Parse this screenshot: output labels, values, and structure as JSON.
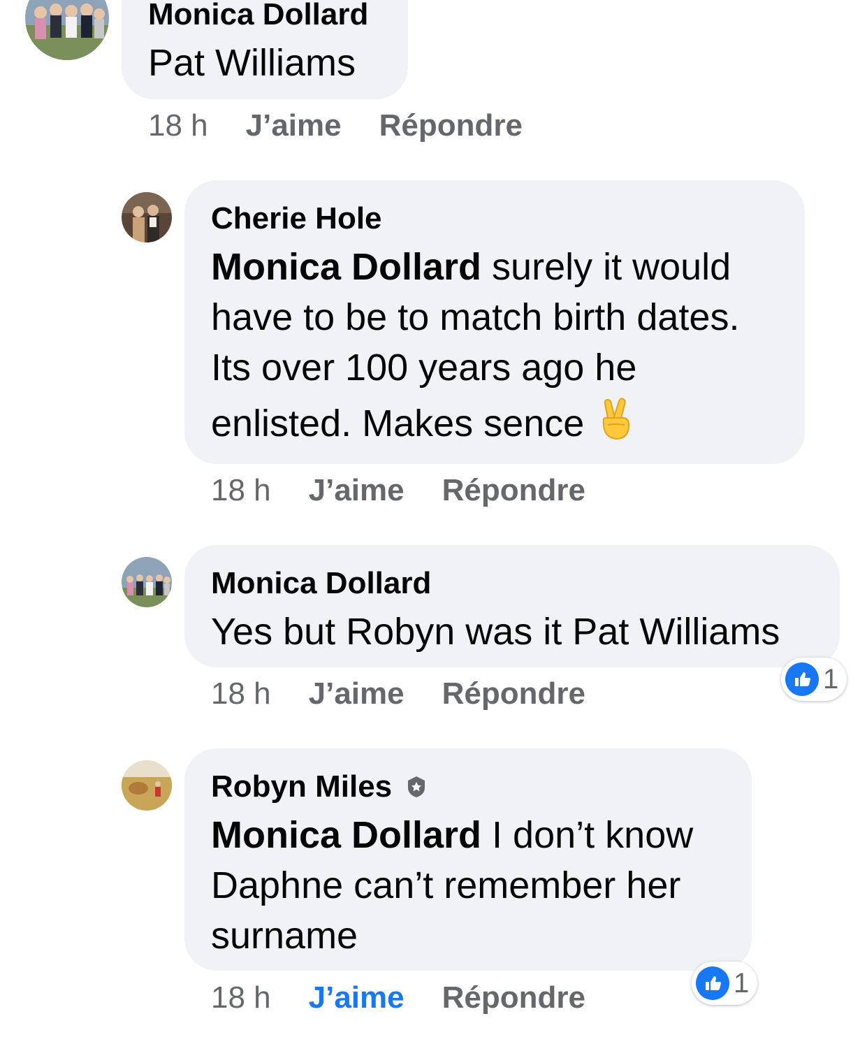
{
  "colors": {
    "bubble": "#f0f2f5",
    "meta_text": "#65676b",
    "like_active": "#1877f2",
    "reaction_badge": "#1877f2"
  },
  "comments": [
    {
      "author": "Monica Dollard",
      "avatar": "group-photo-avatar",
      "lines": [
        [
          {
            "text": "Pat Williams",
            "bold": false
          }
        ]
      ],
      "time": "18 h",
      "like_label": "J’aime",
      "reply_label": "Répondre"
    },
    {
      "author": "Cherie Hole",
      "avatar": "couple-photo-avatar",
      "lines": [
        [
          {
            "text": "Monica Dollard",
            "bold": true
          },
          {
            "text": " surely it would",
            "bold": false
          }
        ],
        [
          {
            "text": "have to be to match birth dates.",
            "bold": false
          }
        ],
        [
          {
            "text": "Its over 100 years ago he",
            "bold": false
          }
        ],
        [
          {
            "text": "enlisted. Makes sence",
            "bold": false
          }
        ]
      ],
      "trailing_emoji": "crossed-fingers-emoji",
      "time": "18 h",
      "like_label": "J’aime",
      "reply_label": "Répondre"
    },
    {
      "author": "Monica Dollard",
      "avatar": "group-photo-avatar",
      "lines": [
        [
          {
            "text": "Yes but Robyn was it Pat Williams",
            "bold": false
          }
        ]
      ],
      "time": "18 h",
      "like_label": "J’aime",
      "reply_label": "Répondre",
      "reaction_icon": "thumbs-up-icon",
      "reaction_count": "1"
    },
    {
      "author": "Robyn Miles",
      "avatar": "field-photo-avatar",
      "author_badge": "top-fan-badge-icon",
      "lines": [
        [
          {
            "text": "Monica Dollard",
            "bold": true
          },
          {
            "text": " I don’t know",
            "bold": false
          }
        ],
        [
          {
            "text": "Daphne can’t remember her",
            "bold": false
          }
        ],
        [
          {
            "text": "surname",
            "bold": false
          }
        ]
      ],
      "time": "18 h",
      "like_label": "J’aime",
      "like_active": true,
      "reply_label": "Répondre",
      "reaction_icon": "thumbs-up-icon",
      "reaction_count": "1"
    }
  ]
}
